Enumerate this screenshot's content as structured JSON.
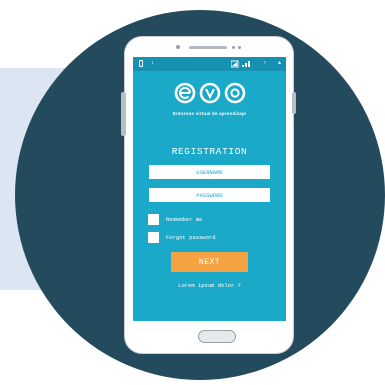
{
  "app": {
    "logo_text": "evo",
    "tagline": "Entornos virtual de aprendizaje"
  },
  "form": {
    "title": "REGISTRATION",
    "username_placeholder": "USERNAME",
    "password_placeholder": "PASSWORD",
    "remember_label": "Remember me",
    "forgot_label": "Forgot password",
    "next_label": "NEXT",
    "link_text": "Lorem ipsum dolor ?"
  },
  "statusbar": {
    "left_icon": "battery-icon",
    "arrow_icon": "download-arrow-icon",
    "signal_icon": "signal-bars-icon",
    "chevron_icon": "chevron-left-icon",
    "end_icon": "triangle-icon"
  },
  "colors": {
    "background_circle": "#244a5e",
    "background_rect": "#dbe6f2",
    "screen": "#1aa9c9",
    "statusbar": "#1691b2",
    "button": "#f5a342"
  }
}
